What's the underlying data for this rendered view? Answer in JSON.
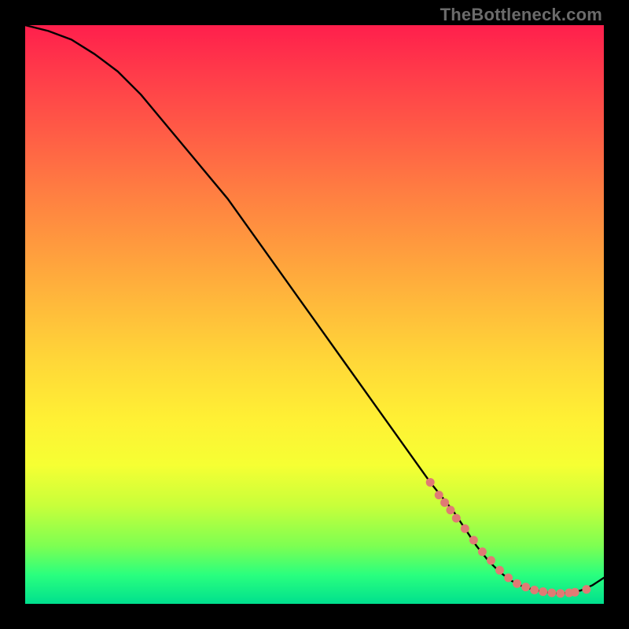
{
  "watermark": "TheBottleneck.com",
  "chart_data": {
    "type": "line",
    "title": "",
    "xlabel": "",
    "ylabel": "",
    "xlim": [
      0,
      100
    ],
    "ylim": [
      0,
      100
    ],
    "grid": false,
    "legend": false,
    "series": [
      {
        "name": "bottleneck-curve",
        "x": [
          0,
          4,
          8,
          12,
          16,
          20,
          25,
          30,
          35,
          40,
          45,
          50,
          55,
          60,
          65,
          70,
          72,
          74,
          76,
          78,
          80,
          82,
          84,
          86,
          88,
          90,
          92,
          94,
          96,
          98,
          100
        ],
        "y": [
          100,
          99,
          97.5,
          95,
          92,
          88,
          82,
          76,
          70,
          63,
          56,
          49,
          42,
          35,
          28,
          21,
          18.5,
          16,
          13,
          10,
          7.5,
          5.5,
          4,
          3,
          2.4,
          2.0,
          1.8,
          1.9,
          2.3,
          3.2,
          4.5
        ]
      }
    ],
    "highlight_points": {
      "name": "marker-dots",
      "color": "#e07b74",
      "points": [
        {
          "x": 70,
          "y": 21
        },
        {
          "x": 71.5,
          "y": 18.8
        },
        {
          "x": 72.5,
          "y": 17.5
        },
        {
          "x": 73.5,
          "y": 16.2
        },
        {
          "x": 74.5,
          "y": 14.8
        },
        {
          "x": 76,
          "y": 13
        },
        {
          "x": 77.5,
          "y": 11
        },
        {
          "x": 79,
          "y": 9
        },
        {
          "x": 80.5,
          "y": 7.5
        },
        {
          "x": 82,
          "y": 5.8
        },
        {
          "x": 83.5,
          "y": 4.5
        },
        {
          "x": 85,
          "y": 3.5
        },
        {
          "x": 86.5,
          "y": 2.9
        },
        {
          "x": 88,
          "y": 2.4
        },
        {
          "x": 89.5,
          "y": 2.1
        },
        {
          "x": 91,
          "y": 1.9
        },
        {
          "x": 92.5,
          "y": 1.8
        },
        {
          "x": 94,
          "y": 1.9
        },
        {
          "x": 95,
          "y": 2.0
        },
        {
          "x": 97,
          "y": 2.5
        }
      ]
    }
  }
}
